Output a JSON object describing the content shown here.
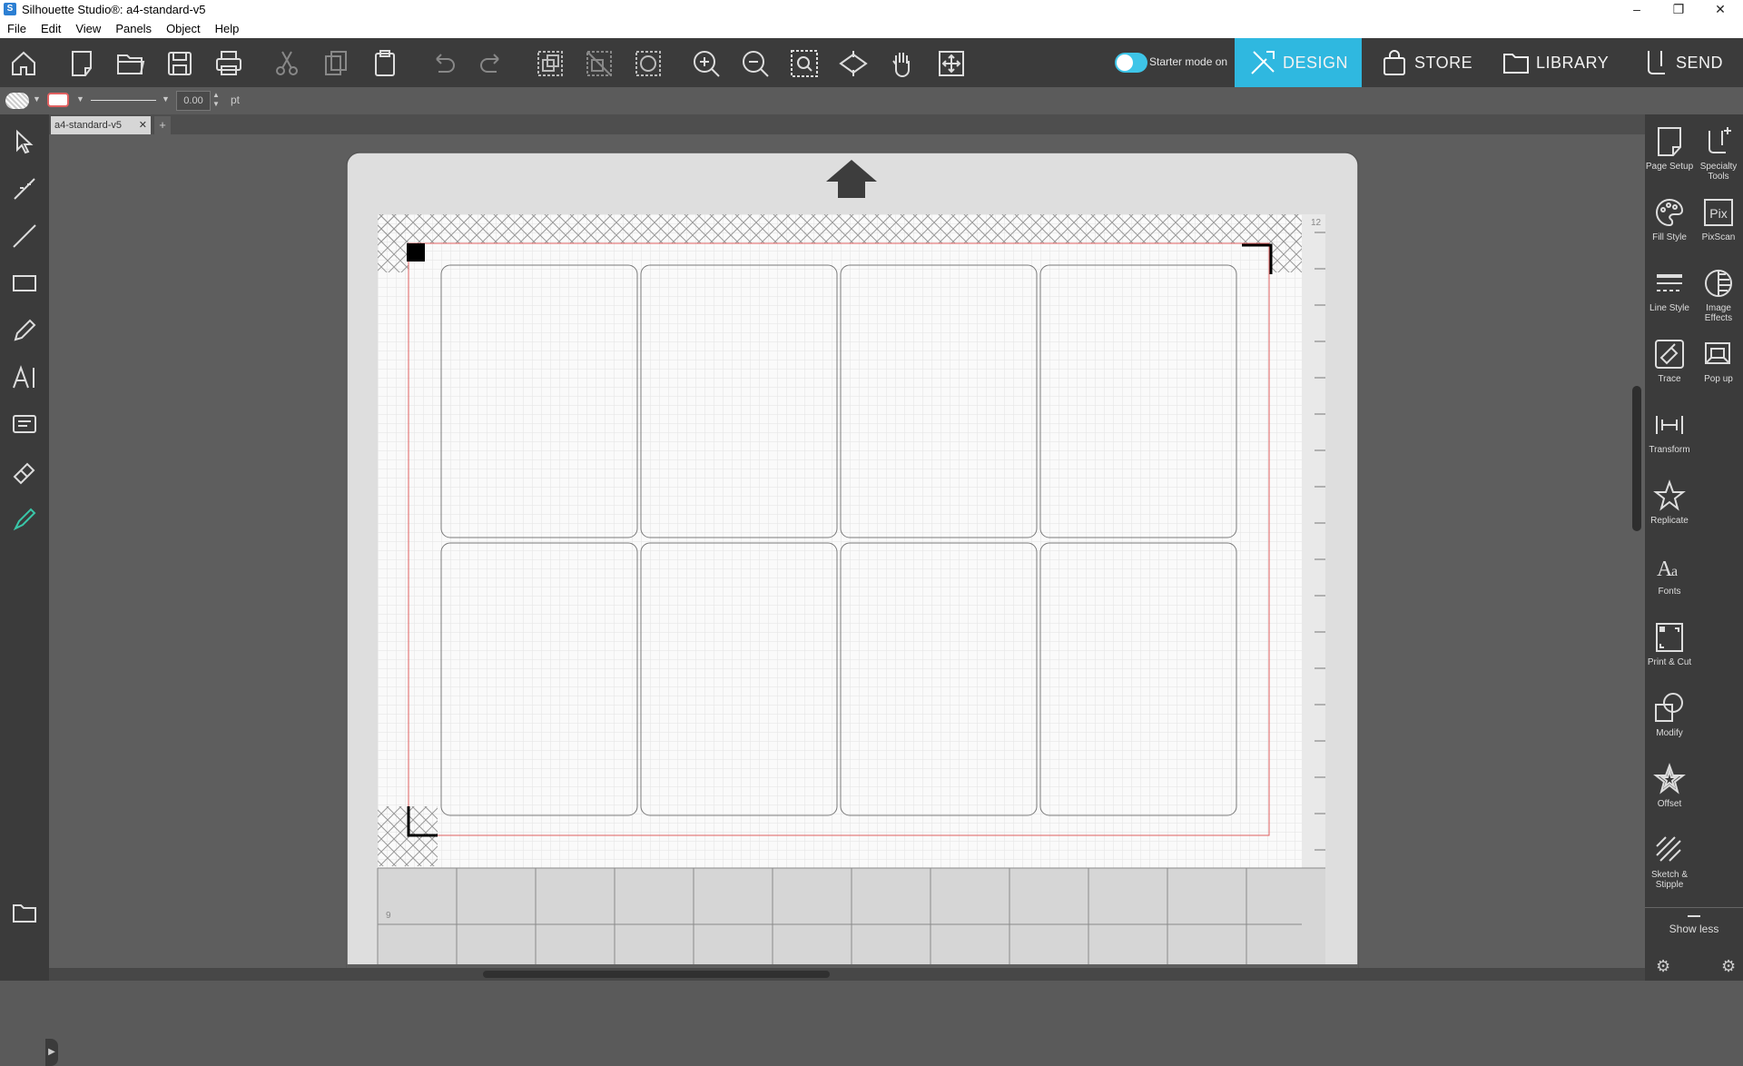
{
  "window": {
    "title": "Silhouette Studio®: a4-standard-v5"
  },
  "menu": [
    "File",
    "Edit",
    "View",
    "Panels",
    "Object",
    "Help"
  ],
  "toolbar": {
    "starter_mode_label": "Starter mode on",
    "nav": [
      {
        "label": "DESIGN",
        "icon": "design-icon",
        "active": true
      },
      {
        "label": "STORE",
        "icon": "shopping-bag-icon",
        "active": false
      },
      {
        "label": "LIBRARY",
        "icon": "folder-icon",
        "active": false
      },
      {
        "label": "SEND",
        "icon": "send-icon",
        "active": false
      }
    ]
  },
  "properties": {
    "line_width_value": "0.00",
    "line_width_unit": "pt"
  },
  "document": {
    "tab_label": "a4-standard-v5",
    "add_tab": "+"
  },
  "ruler": {
    "top_number": "12",
    "bottom_number": "9"
  },
  "right_panel": {
    "items": [
      {
        "label": "Page Setup",
        "icon": "page-setup-icon"
      },
      {
        "label": "Specialty Tools",
        "icon": "specialty-tools-icon"
      },
      {
        "label": "Fill Style",
        "icon": "palette-icon"
      },
      {
        "label": "PixScan",
        "icon": "pixscan-icon"
      },
      {
        "label": "Line Style",
        "icon": "line-style-icon"
      },
      {
        "label": "Image Effects",
        "icon": "image-effects-icon"
      },
      {
        "label": "Trace",
        "icon": "trace-icon"
      },
      {
        "label": "Pop up",
        "icon": "pop-up-icon"
      },
      {
        "label": "Transform",
        "icon": "transform-icon"
      },
      {
        "label": "Replicate",
        "icon": "replicate-icon"
      },
      {
        "label": "Fonts",
        "icon": "fonts-icon"
      },
      {
        "label": "Print & Cut",
        "icon": "print-cut-icon"
      },
      {
        "label": "Modify",
        "icon": "modify-icon"
      },
      {
        "label": "Offset",
        "icon": "offset-star-icon"
      },
      {
        "label": "Sketch & Stipple",
        "icon": "sketch-stipple-icon"
      }
    ],
    "show_less": "Show less"
  },
  "colors": {
    "accent": "#2fb8e0",
    "toolbar_bg": "#3b3b3b",
    "cut_border": "#e06060"
  }
}
